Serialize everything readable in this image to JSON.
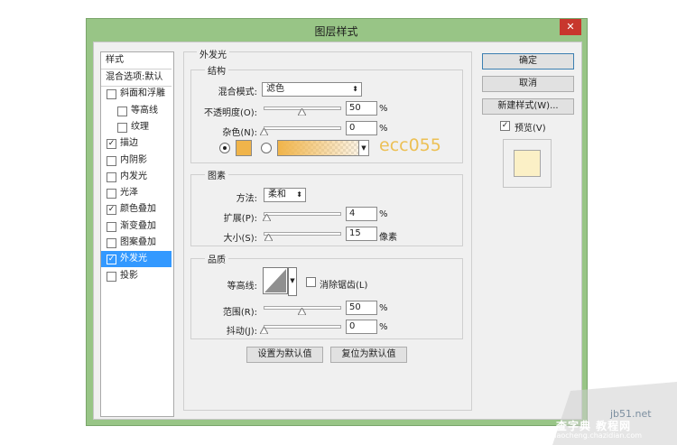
{
  "dialog": {
    "title": "图层样式",
    "close_glyph": "✕"
  },
  "sidebar": {
    "header": "样式",
    "items": [
      {
        "label": "混合选项:默认",
        "has_checkbox": false,
        "checked": false,
        "selected": false
      },
      {
        "label": "斜面和浮雕",
        "has_checkbox": true,
        "checked": false,
        "selected": false
      },
      {
        "label": "等高线",
        "has_checkbox": true,
        "checked": false,
        "selected": false,
        "indent": true
      },
      {
        "label": "纹理",
        "has_checkbox": true,
        "checked": false,
        "selected": false,
        "indent": true
      },
      {
        "label": "描边",
        "has_checkbox": true,
        "checked": true,
        "selected": false
      },
      {
        "label": "内阴影",
        "has_checkbox": true,
        "checked": false,
        "selected": false
      },
      {
        "label": "内发光",
        "has_checkbox": true,
        "checked": false,
        "selected": false
      },
      {
        "label": "光泽",
        "has_checkbox": true,
        "checked": false,
        "selected": false
      },
      {
        "label": "颜色叠加",
        "has_checkbox": true,
        "checked": true,
        "selected": false
      },
      {
        "label": "渐变叠加",
        "has_checkbox": true,
        "checked": false,
        "selected": false
      },
      {
        "label": "图案叠加",
        "has_checkbox": true,
        "checked": false,
        "selected": false
      },
      {
        "label": "外发光",
        "has_checkbox": true,
        "checked": true,
        "selected": true
      },
      {
        "label": "投影",
        "has_checkbox": true,
        "checked": false,
        "selected": false
      }
    ]
  },
  "panel": {
    "title": "外发光",
    "structure": {
      "title": "结构",
      "blend_mode_label": "混合模式:",
      "blend_mode_value": "滤色",
      "opacity_label": "不透明度(O):",
      "opacity_value": "50",
      "opacity_unit": "%",
      "opacity_level": 0.5,
      "noise_label": "杂色(N):",
      "noise_value": "0",
      "noise_unit": "%",
      "noise_level": 0,
      "color_swatch": "#f0b44a",
      "gradient_from": "#f0b44a",
      "color_annotation": "ecc055",
      "annotation_color": "#ecc055"
    },
    "elements": {
      "title": "图素",
      "method_label": "方法:",
      "method_value": "柔和",
      "spread_label": "扩展(P):",
      "spread_value": "4",
      "spread_unit": "%",
      "spread_level": 0.04,
      "size_label": "大小(S):",
      "size_value": "15",
      "size_unit": "像素",
      "size_level": 0.06
    },
    "quality": {
      "title": "品质",
      "contour_label": "等高线:",
      "antialias_label": "消除锯齿(L)",
      "range_label": "范围(R):",
      "range_value": "50",
      "range_unit": "%",
      "range_level": 0.5,
      "jitter_label": "抖动(J):",
      "jitter_value": "0",
      "jitter_unit": "%",
      "jitter_level": 0
    },
    "make_default": "设置为默认值",
    "reset_default": "复位为默认值"
  },
  "right": {
    "ok": "确定",
    "cancel": "取消",
    "new_style": "新建样式(W)...",
    "preview_label": "预览(V)",
    "preview_checked": true,
    "preview_color": "#fbf0c6"
  },
  "watermark": {
    "line1": "jb51.net",
    "line2": "查字典 教程网",
    "line3": "jiaocheng.chazidian.com"
  }
}
